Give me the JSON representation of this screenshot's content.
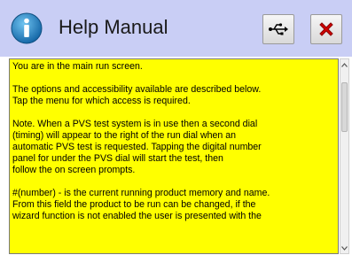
{
  "header": {
    "title": "Help Manual",
    "icons": {
      "info": "info-icon",
      "usb": "usb-icon",
      "close": "close-icon"
    }
  },
  "content": {
    "paragraphs": [
      "You are in the main run screen.",
      "The options and accessibility available are described below.\nTap the menu for which access is required.",
      "Note. When a PVS test system is in use then a second dial\n(timing) will appear to the right of the run dial when an\nautomatic PVS test is requested. Tapping the digital number\npanel for under the PVS dial will start the test, then\nfollow the on screen prompts.",
      "#(number) - is the current running product memory and name.\nFrom this field the product to be run can be changed, if the\nwizard function is not enabled the user is presented with the"
    ]
  },
  "colors": {
    "header_bg": "#c9cef5",
    "content_bg": "#ffff00",
    "close_red": "#d40000",
    "info_blue": "#1f7fbf"
  }
}
